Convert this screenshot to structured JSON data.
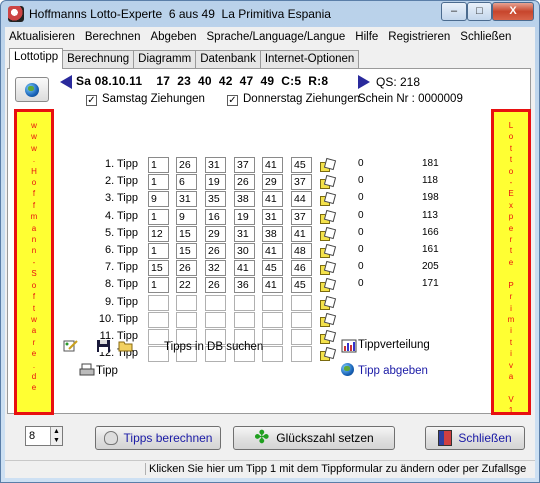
{
  "window": {
    "title": "Hoffmanns Lotto-Experte  6 aus 49  La Primitiva Espania",
    "min_label": "–",
    "max_label": "□",
    "close_label": "X"
  },
  "menu": [
    "Aktualisieren",
    "Berechnen",
    "Abgeben",
    "Sprache/Language/Langue",
    "Hilfe",
    "Registrieren",
    "Schließen"
  ],
  "tabs": [
    "Lottotipp",
    "Berechnung",
    "Diagramm",
    "Datenbank",
    "Internet-Optionen"
  ],
  "draw": {
    "line": "Sa 08.10.11    17  23  40  42  47  49  C:5  R:8",
    "qs": "QS: 218"
  },
  "options": {
    "samstag_label": "Samstag Ziehungen",
    "samstag_checked": "✓",
    "donnerstag_label": "Donnerstag Ziehungen",
    "donnerstag_checked": "✓",
    "schein": "Schein Nr : 0000009"
  },
  "banners": {
    "left": "w\nw\nw\n.\nH\no\nf\nf\nm\na\nn\nn\n-\nS\no\nf\nt\nw\na\nr\ne\n.\nd\ne",
    "right": "L\no\nt\nt\no\n-\nE\nx\np\ne\nr\nt\ne\n \nP\nr\ni\nm\ni\nt\ni\nv\na\n \nV\n1"
  },
  "tipps": [
    {
      "label": "1. Tipp",
      "numbers": [
        "1",
        "26",
        "31",
        "37",
        "41",
        "45"
      ],
      "stat_a": "0",
      "stat_b": "181"
    },
    {
      "label": "2. Tipp",
      "numbers": [
        "1",
        "6",
        "19",
        "26",
        "29",
        "37"
      ],
      "stat_a": "0",
      "stat_b": "118"
    },
    {
      "label": "3. Tipp",
      "numbers": [
        "9",
        "31",
        "35",
        "38",
        "41",
        "44"
      ],
      "stat_a": "0",
      "stat_b": "198"
    },
    {
      "label": "4. Tipp",
      "numbers": [
        "1",
        "9",
        "16",
        "19",
        "31",
        "37"
      ],
      "stat_a": "0",
      "stat_b": "113"
    },
    {
      "label": "5. Tipp",
      "numbers": [
        "12",
        "15",
        "29",
        "31",
        "38",
        "41"
      ],
      "stat_a": "0",
      "stat_b": "166"
    },
    {
      "label": "6. Tipp",
      "numbers": [
        "1",
        "15",
        "26",
        "30",
        "41",
        "48"
      ],
      "stat_a": "0",
      "stat_b": "161"
    },
    {
      "label": "7. Tipp",
      "numbers": [
        "15",
        "26",
        "32",
        "41",
        "45",
        "46"
      ],
      "stat_a": "0",
      "stat_b": "205"
    },
    {
      "label": "8. Tipp",
      "numbers": [
        "1",
        "22",
        "26",
        "36",
        "41",
        "45"
      ],
      "stat_a": "0",
      "stat_b": "171"
    },
    {
      "label": "9. Tipp",
      "numbers": [
        "",
        "",
        "",
        "",
        "",
        ""
      ],
      "stat_a": "",
      "stat_b": ""
    },
    {
      "label": "10. Tipp",
      "numbers": [
        "",
        "",
        "",
        "",
        "",
        ""
      ],
      "stat_a": "",
      "stat_b": ""
    },
    {
      "label": "11. Tipp",
      "numbers": [
        "",
        "",
        "",
        "",
        "",
        ""
      ],
      "stat_a": "",
      "stat_b": ""
    },
    {
      "label": "12. Tipp",
      "numbers": [
        "",
        "",
        "",
        "",
        "",
        ""
      ],
      "stat_a": "",
      "stat_b": ""
    }
  ],
  "actions": {
    "db_search": "Tipps in DB suchen",
    "print_tipp": "Tipp",
    "verteilung": "Tippverteilung",
    "abgeben": "Tipp abgeben"
  },
  "bottom": {
    "spin_value": "8",
    "calc_button": "Tipps berechnen",
    "lucky_button": "Glückszahl setzen",
    "close_button": "Schließen"
  },
  "status": "Klicken Sie hier um Tipp 1 mit dem Tippformular zu ändern oder per Zufallsge",
  "colors": {
    "banner_bg": "#ffff33",
    "banner_border": "#e81010",
    "link": "#1a1aa6"
  }
}
